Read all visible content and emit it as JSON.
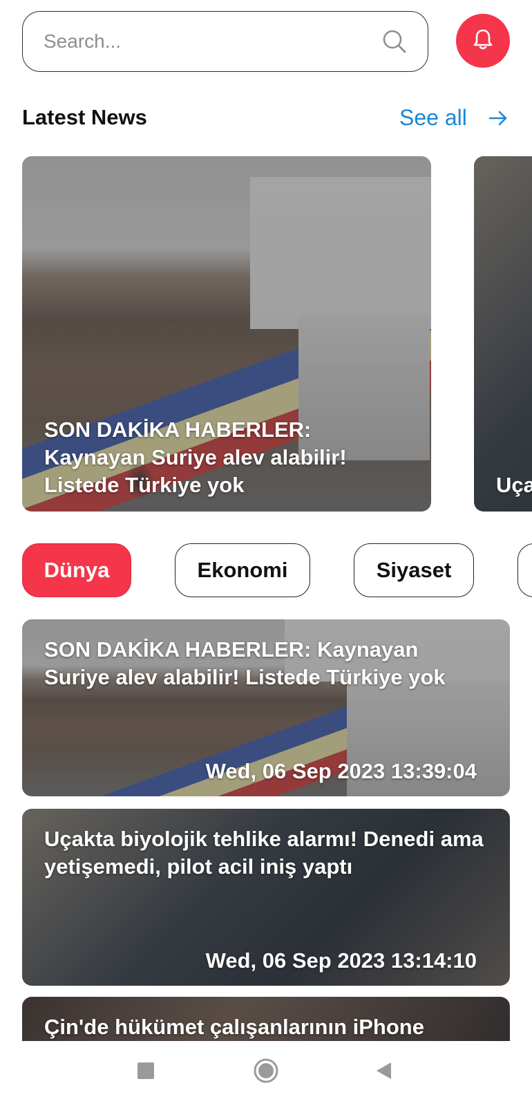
{
  "search": {
    "placeholder": "Search...",
    "icon": "search-icon"
  },
  "notification": {
    "icon": "bell-icon",
    "color": "#f4354a"
  },
  "latest": {
    "title": "Latest News",
    "see_all": "See all",
    "arrow_icon": "arrow-right-icon",
    "cards": [
      {
        "title": "SON DAKİKA HABERLER: Kaynayan Suriye alev alabilir! Listede Türkiye yok"
      },
      {
        "title": "Uça Der iniş"
      }
    ]
  },
  "categories": [
    {
      "label": "Dünya",
      "active": true
    },
    {
      "label": "Ekonomi",
      "active": false
    },
    {
      "label": "Siyaset",
      "active": false
    },
    {
      "label": "",
      "active": false
    }
  ],
  "news": [
    {
      "title": "SON DAKİKA HABERLER: Kaynayan Suriye alev alabilir! Listede Türkiye yok",
      "date": "Wed, 06 Sep 2023 13:39:04"
    },
    {
      "title": "Uçakta biyolojik tehlike alarmı! Denedi ama yetişemedi, pilot acil iniş yaptı",
      "date": "Wed, 06 Sep 2023 13:14:10"
    },
    {
      "title": "Çin'de hükümet çalışanlarının iPhone",
      "date": ""
    }
  ],
  "navbar": {
    "recent_icon": "square-icon",
    "home_icon": "circle-icon",
    "back_icon": "triangle-back-icon"
  },
  "colors": {
    "accent": "#f4354a",
    "link": "#1a86d8"
  }
}
